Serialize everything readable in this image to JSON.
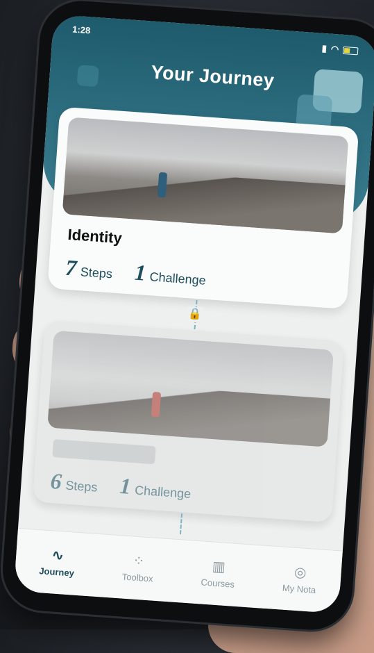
{
  "status": {
    "time": "1:28"
  },
  "header": {
    "title": "Your Journey"
  },
  "cards": [
    {
      "title": "Identity",
      "steps_num": "7",
      "steps_label": "Steps",
      "challenge_num": "1",
      "challenge_label": "Challenge"
    },
    {
      "title": "",
      "steps_num": "6",
      "steps_label": "Steps",
      "challenge_num": "1",
      "challenge_label": "Challenge"
    }
  ],
  "tabs": [
    {
      "label": "Journey",
      "icon": "route-icon"
    },
    {
      "label": "Toolbox",
      "icon": "grid-icon"
    },
    {
      "label": "Courses",
      "icon": "books-icon"
    },
    {
      "label": "My Nota",
      "icon": "fingerprint-icon"
    }
  ],
  "colors": {
    "accent": "#1d4e5d",
    "header": "#2b6a7c"
  }
}
